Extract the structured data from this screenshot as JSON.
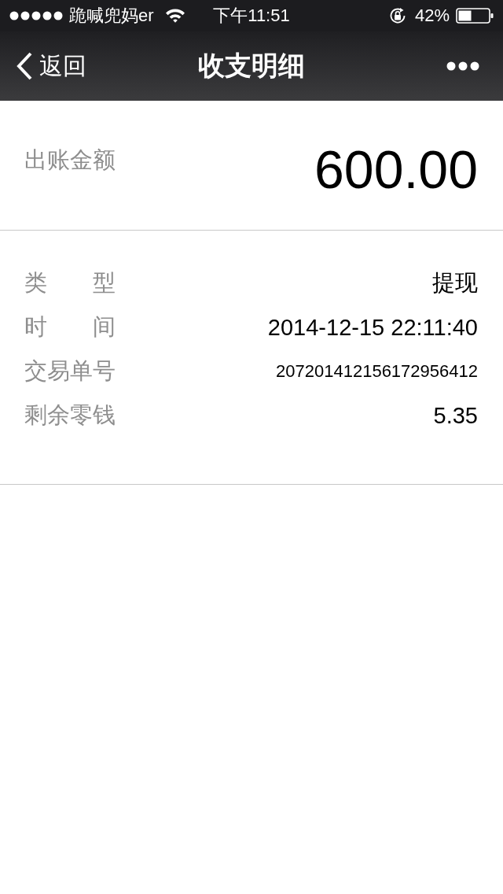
{
  "status_bar": {
    "carrier": "跪喊兜妈er",
    "time": "下午11:51",
    "battery": "42%"
  },
  "nav_bar": {
    "back": "返回",
    "title": "收支明细"
  },
  "amount": {
    "label": "出账金额",
    "value": "600.00"
  },
  "details": [
    {
      "label": "类　　型",
      "value": "提现",
      "kind": "normal"
    },
    {
      "label": "时　　间",
      "value": "2014-12-15 22:11:40",
      "kind": "normal"
    },
    {
      "label": "交易单号",
      "value": "207201412156172956412",
      "kind": "small"
    },
    {
      "label": "剩余零钱",
      "value": "5.35",
      "kind": "normal"
    }
  ]
}
